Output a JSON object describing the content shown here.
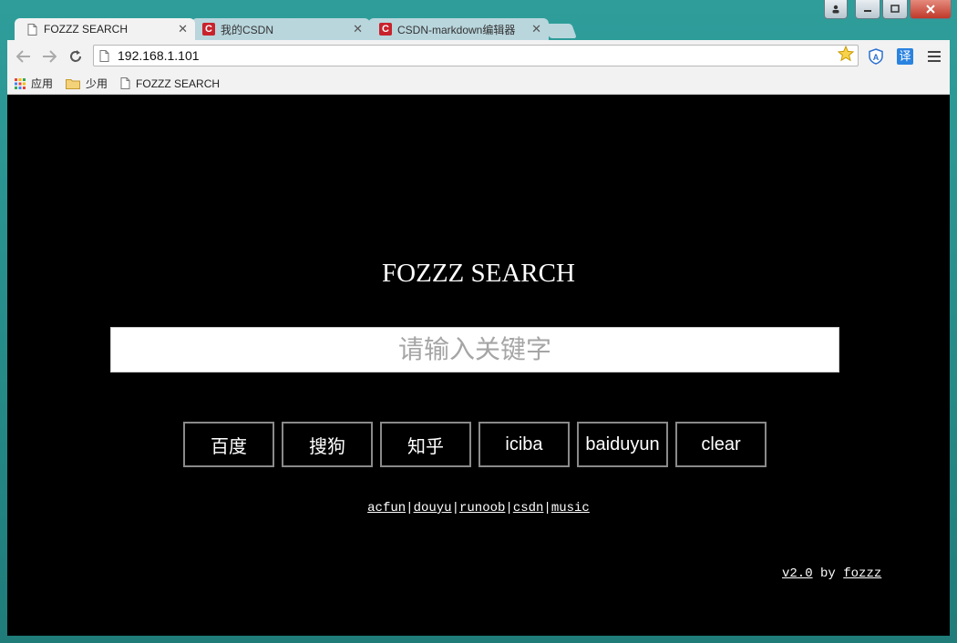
{
  "browser": {
    "tabs": [
      {
        "title": "FOZZZ SEARCH",
        "close": "✕"
      },
      {
        "title": "我的CSDN",
        "close": "✕"
      },
      {
        "title": "CSDN-markdown编辑器",
        "close": "✕"
      }
    ],
    "csdn_icon_letter": "C",
    "url": "192.168.1.101",
    "ext_translate": "译",
    "bookmarks": [
      {
        "label": "应用"
      },
      {
        "label": "少用"
      },
      {
        "label": "FOZZZ SEARCH"
      }
    ]
  },
  "page": {
    "title": "FOZZZ SEARCH",
    "search_placeholder": "请输入关键字",
    "buttons": [
      "百度",
      "搜狗",
      "知乎",
      "iciba",
      "baiduyun",
      "clear"
    ],
    "links": [
      "acfun",
      "douyu",
      "runoob",
      "csdn",
      "music"
    ],
    "link_separator": "|",
    "footer": {
      "version": "v2.0",
      "by": "by",
      "author": "fozzz"
    }
  },
  "colors": {
    "page_background": "#000000",
    "text": "#ffffff",
    "button_border": "#8a8a8a",
    "frame": "#2b8f8c"
  }
}
